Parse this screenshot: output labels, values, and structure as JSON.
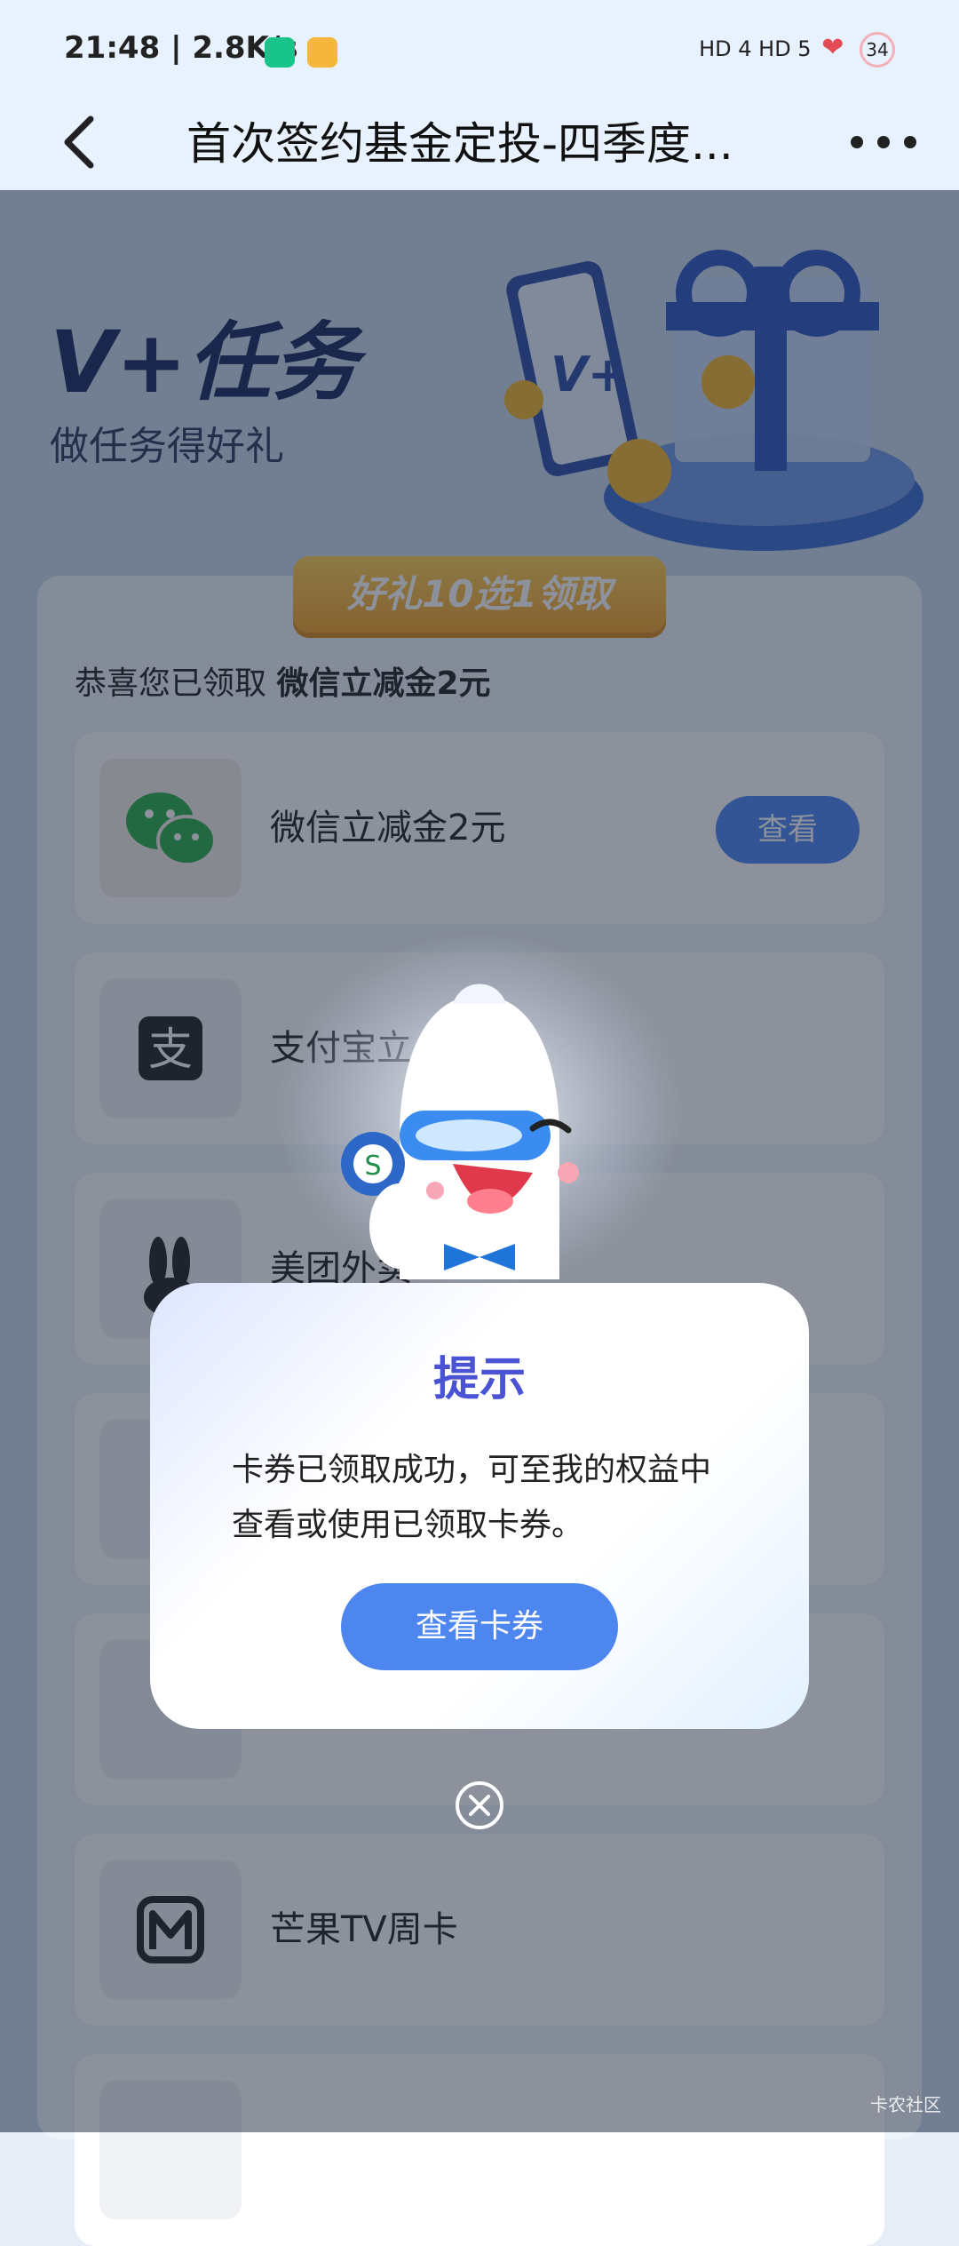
{
  "status_bar": {
    "time": "21:48 | 2.8K/s",
    "signal_text": "HD 4  HD 5",
    "battery": "34"
  },
  "nav": {
    "title": "首次签约基金定投-四季度..."
  },
  "hero": {
    "title": "V+任务",
    "subtitle": "做任务得好礼",
    "ribbon": "好礼10选1领取"
  },
  "rewards": {
    "congrats_prefix": "恭喜您已领取 ",
    "congrats_item": "微信立减金2元",
    "items": [
      {
        "label": "微信立减金2元",
        "button": "查看"
      },
      {
        "label": "支付宝立"
      },
      {
        "label": "美团外卖"
      },
      {
        "label": ""
      },
      {
        "label": ""
      },
      {
        "label": "芒果TV周卡"
      }
    ]
  },
  "dialog": {
    "title": "提示",
    "message": "卡券已领取成功，可至我的权益中查看或使用已领取卡券。",
    "button": "查看卡券"
  },
  "watermark": "卡农社区"
}
